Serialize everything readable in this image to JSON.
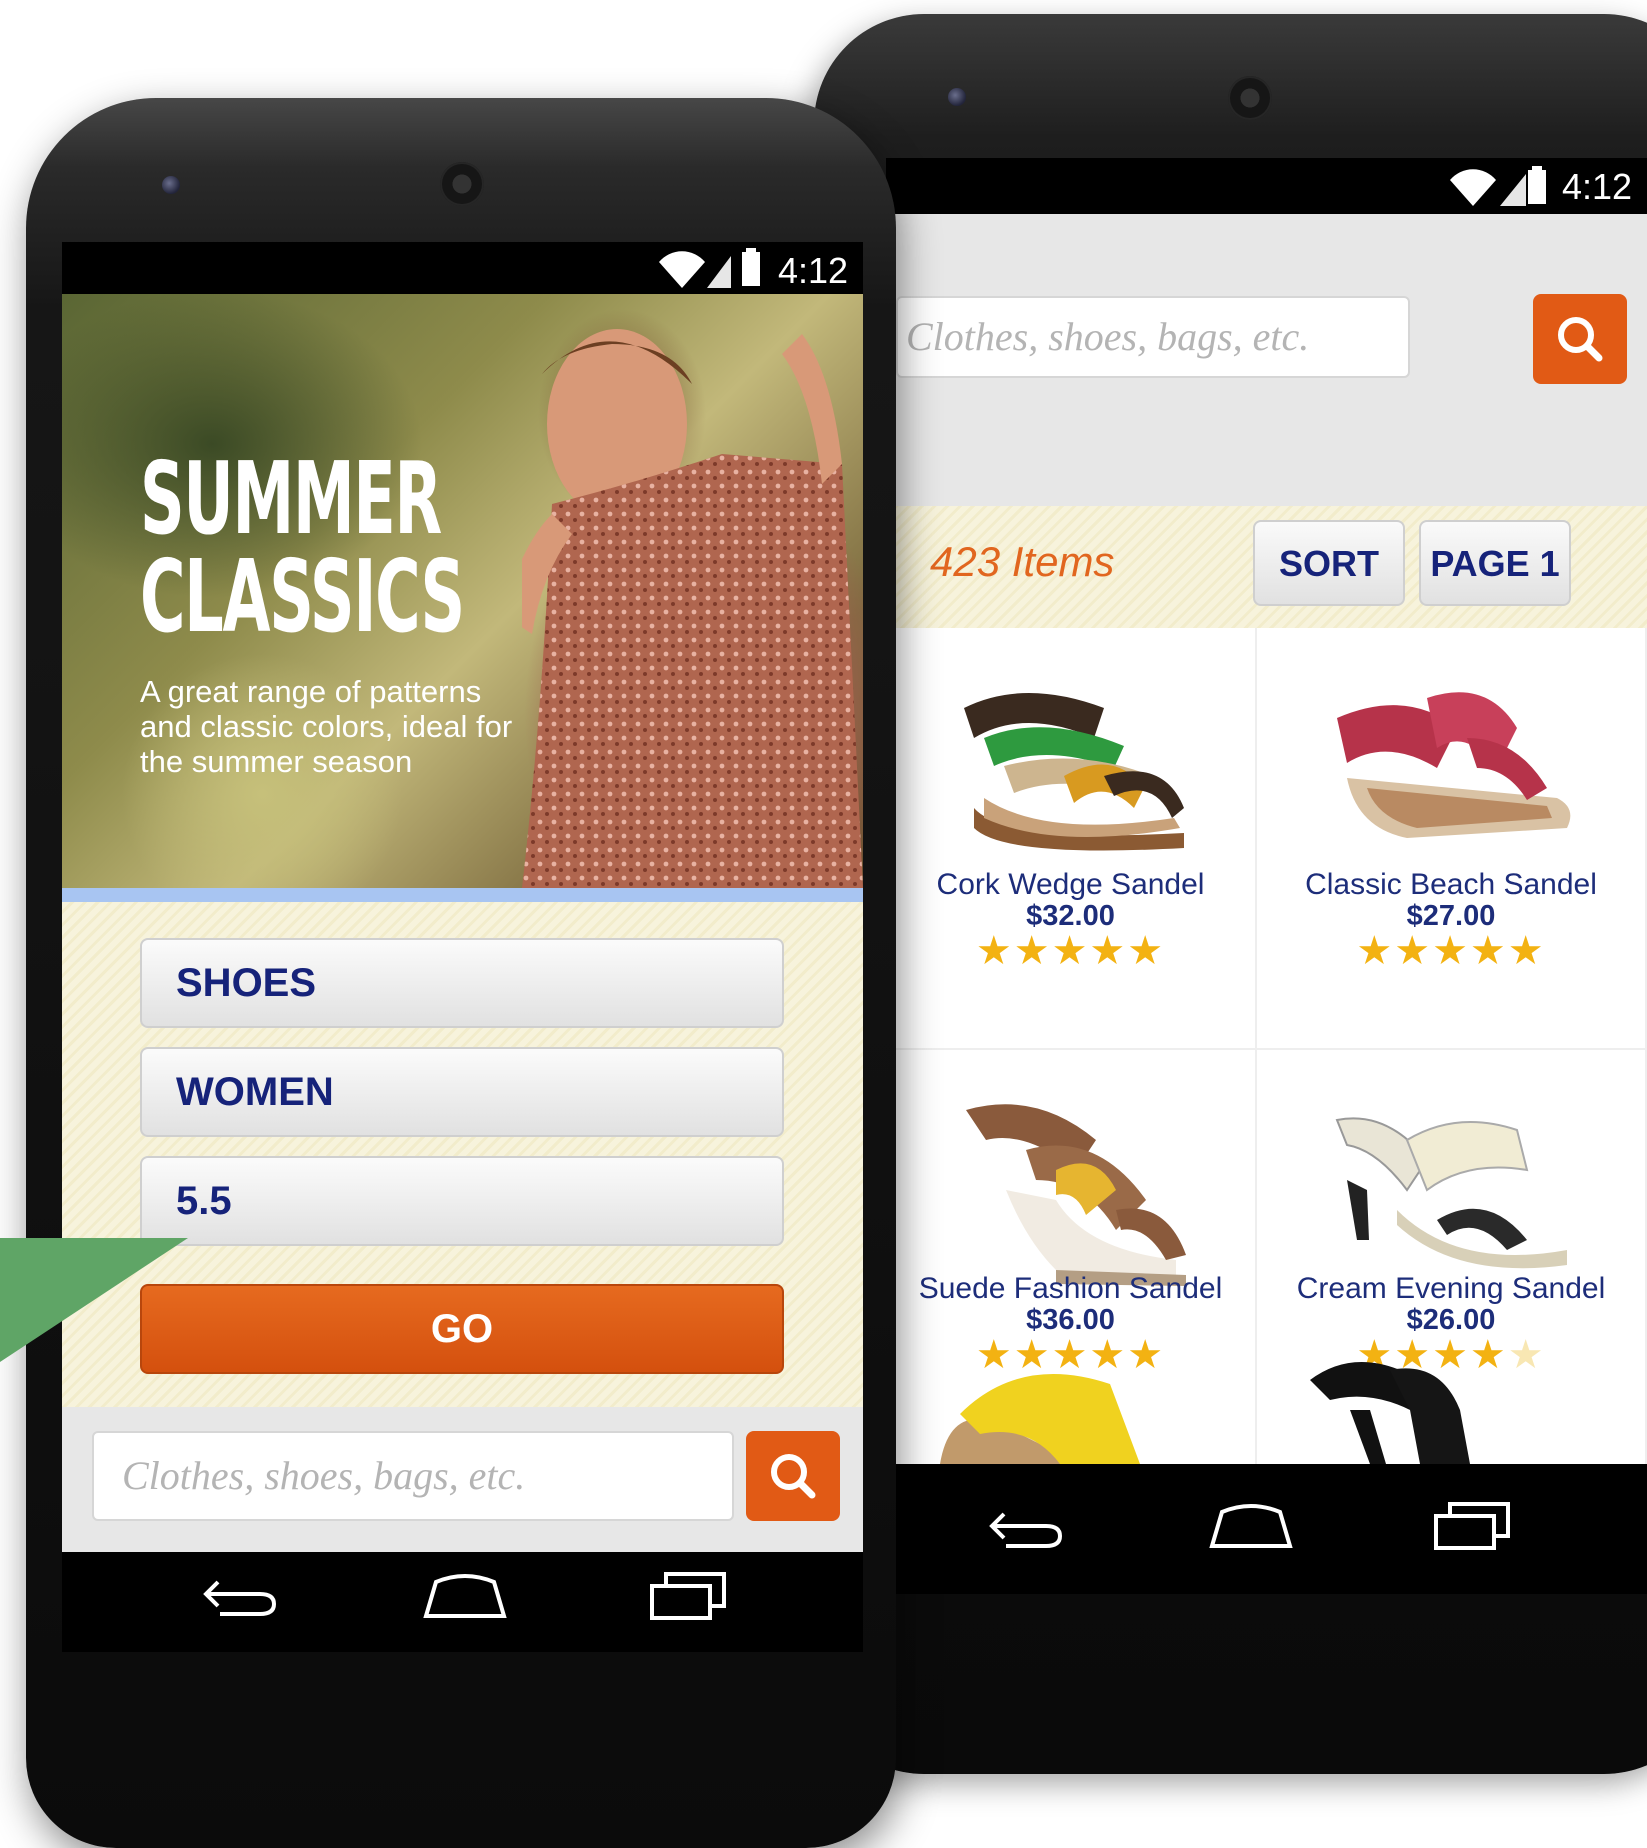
{
  "status_bar": {
    "time": "4:12"
  },
  "front_screen": {
    "hero": {
      "title_line1": "SUMMER",
      "title_line2": "CLASSICS",
      "subtitle": "A great range of patterns and classic colors, ideal for the summer season"
    },
    "selectors": {
      "category": "SHOES",
      "gender": "WOMEN",
      "size": "5.5"
    },
    "go_label": "GO",
    "search": {
      "placeholder": "Clothes, shoes, bags, etc."
    }
  },
  "back_screen": {
    "search": {
      "placeholder": "Clothes, shoes, bags, etc."
    },
    "toolbar": {
      "item_count": "423 Items",
      "sort_label": "SORT",
      "page_label": "PAGE 1"
    },
    "products": [
      {
        "name": "Cork Wedge Sandel",
        "price": "$32.00",
        "rating": 5
      },
      {
        "name": "Classic Beach Sandel",
        "price": "$27.00",
        "rating": 5
      },
      {
        "name": "Suede Fashion Sandel",
        "price": "$36.00",
        "rating": 5
      },
      {
        "name": "Cream Evening Sandel",
        "price": "$26.00",
        "rating": 4
      }
    ]
  },
  "icons": {
    "search": "search-icon",
    "back": "back-icon",
    "home": "home-icon",
    "recents": "recent-apps-icon",
    "wifi": "wifi-icon",
    "signal": "signal-icon",
    "battery": "battery-icon"
  },
  "colors": {
    "accent_orange": "#e15a15",
    "brand_navy": "#16237a",
    "item_count_orange": "#e1661f",
    "star_gold": "#f3b212"
  }
}
